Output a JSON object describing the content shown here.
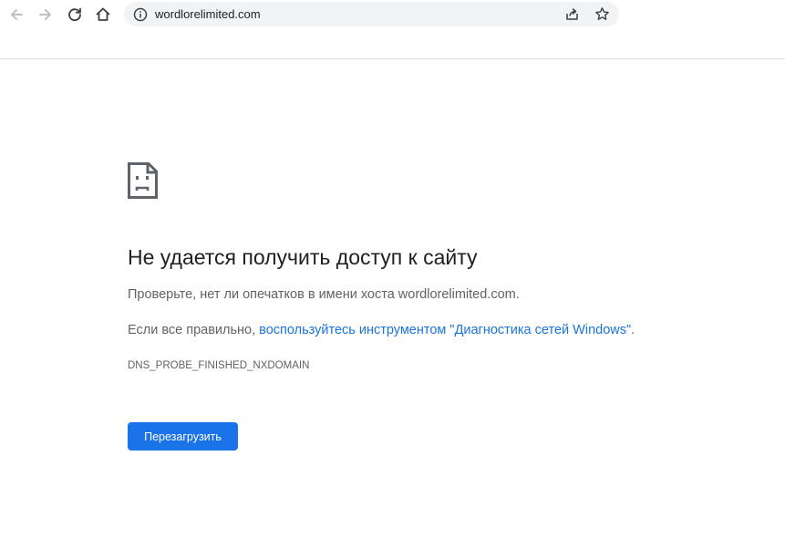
{
  "browser": {
    "url": "wordlorelimited.com",
    "icons": {
      "back": "arrow-left-icon",
      "forward": "arrow-right-icon",
      "reload": "reload-icon",
      "home": "home-icon",
      "site_info": "info-icon",
      "share": "share-icon",
      "bookmark": "star-icon"
    }
  },
  "error_page": {
    "icon": "sad-document-icon",
    "title": "Не удается получить доступ к сайту",
    "check_text": "Проверьте, нет ли опечатков в имени хоста wordlorelimited.com.",
    "suggest_prefix": "Если все правильно, ",
    "suggest_link": "воспользуйтесь инструментом \"Диагностика сетей Windows\"",
    "suggest_suffix": ".",
    "error_code": "DNS_PROBE_FINISHED_NXDOMAIN",
    "reload_label": "Перезагрузить"
  },
  "colors": {
    "accent": "#1a73e8",
    "text": "#202124",
    "secondary_text": "#5f6368",
    "omnibox_bg": "#f1f3f4"
  }
}
